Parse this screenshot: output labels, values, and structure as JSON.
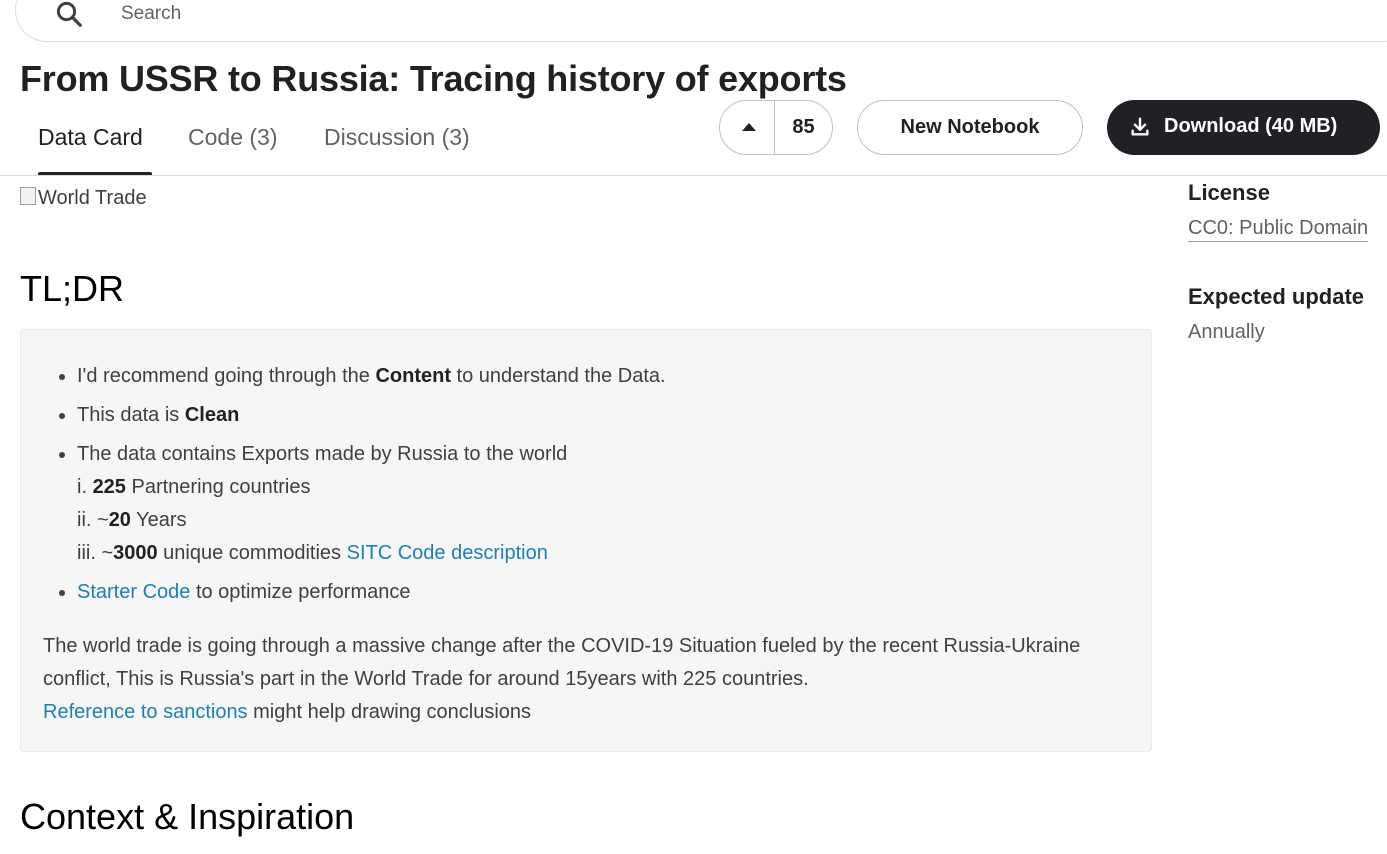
{
  "search": {
    "placeholder": "Search"
  },
  "dataset": {
    "title": "From USSR to Russia: Tracing history of exports"
  },
  "tabs": [
    {
      "label": "Data Card",
      "active": true
    },
    {
      "label": "Code (3)"
    },
    {
      "label": "Discussion (3)"
    }
  ],
  "actions": {
    "upvote_count": "85",
    "new_notebook": "New Notebook",
    "download": "Download (40 MB)"
  },
  "content": {
    "image_alt": "World Trade",
    "tldr_heading": "TL;DR",
    "bullets": {
      "b1_pre": "I'd recommend going through the ",
      "b1_bold": "Content",
      "b1_post": " to understand the Data.",
      "b2_pre": "This data is ",
      "b2_bold": "Clean",
      "b3": "The data contains Exports made by Russia to the world",
      "s1_prefix": "i. ",
      "s1_bold": "225",
      "s1_text": " Partnering countries",
      "s2_prefix": "ii. ~",
      "s2_bold": "20",
      "s2_text": " Years",
      "s3_prefix": "iii. ~",
      "s3_bold": "3000",
      "s3_text": " unique commodities ",
      "s3_link": "SITC Code description",
      "b4_link": "Starter Code",
      "b4_post": " to optimize performance"
    },
    "paragraph": "The world trade is going through a massive change after the COVID-19 Situation fueled by the recent Russia-Ukraine conflict, This is Russia's part in the World Trade for around 15years with 225 countries.",
    "paragraph_link": "Reference to sanctions",
    "paragraph_post": " might help drawing conclusions",
    "context_heading": "Context & Inspiration"
  },
  "sidebar": {
    "license_label": "License",
    "license_value": "CC0: Public Domain",
    "update_label": "Expected update",
    "update_value": "Annually"
  },
  "icons": {
    "search": "search-icon",
    "upvote": "triangle-up-icon",
    "download": "download-icon"
  }
}
